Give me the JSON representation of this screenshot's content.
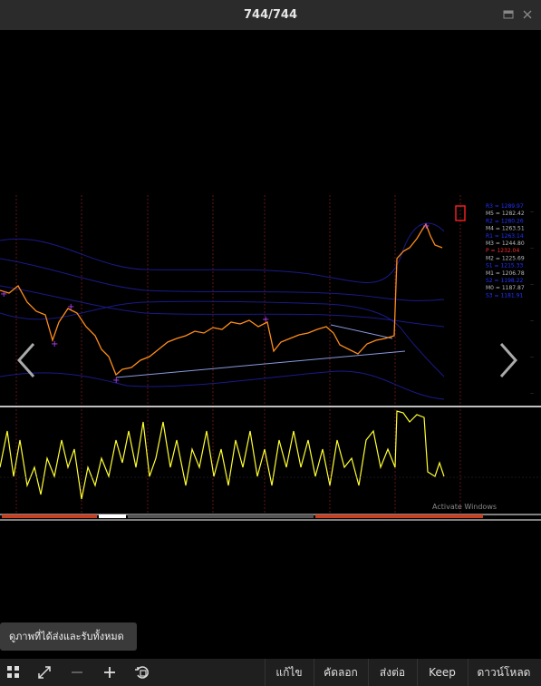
{
  "window": {
    "title": "744/744"
  },
  "chart": {
    "levels": [
      {
        "label": "R3 = 1289.97",
        "color": "#2233ff"
      },
      {
        "label": "M5 = 1282.42",
        "color": "#bbbbbb"
      },
      {
        "label": "R2 = 1280.26",
        "color": "#2233ff"
      },
      {
        "label": "M4 = 1263.51",
        "color": "#bbbbbb"
      },
      {
        "label": "R1 = 1263.14",
        "color": "#2233ff"
      },
      {
        "label": "M3 = 1244.80",
        "color": "#bbbbbb"
      },
      {
        "label": "P = 1232.04",
        "color": "#ff2a2a"
      },
      {
        "label": "M2 = 1225.69",
        "color": "#bbbbbb"
      },
      {
        "label": "S1 = 1215.33",
        "color": "#2233ff"
      },
      {
        "label": "M1 = 1206.78",
        "color": "#bbbbbb"
      },
      {
        "label": "S2 = 1198.22",
        "color": "#2233ff"
      },
      {
        "label": "M0 = 1187.87",
        "color": "#bbbbbb"
      },
      {
        "label": "S3 = 1181.91",
        "color": "#2233ff"
      }
    ],
    "watermark": "Activate Windows"
  },
  "tooltip": {
    "text": "ดูภาพที่ได้ส่งและรับทั้งหมด"
  },
  "toolbar": {
    "edit_label": "แก้ไข",
    "copy_label": "คัดลอก",
    "forward_label": "ส่งต่อ",
    "keep_label": "Keep",
    "download_label": "ดาวน์โหลด"
  },
  "icons": [
    "grid-icon",
    "expand-icon",
    "zoom-out-icon",
    "zoom-in-icon",
    "rotate-icon",
    "minimize-icon",
    "close-icon",
    "chevron-left-icon",
    "chevron-right-icon"
  ]
}
